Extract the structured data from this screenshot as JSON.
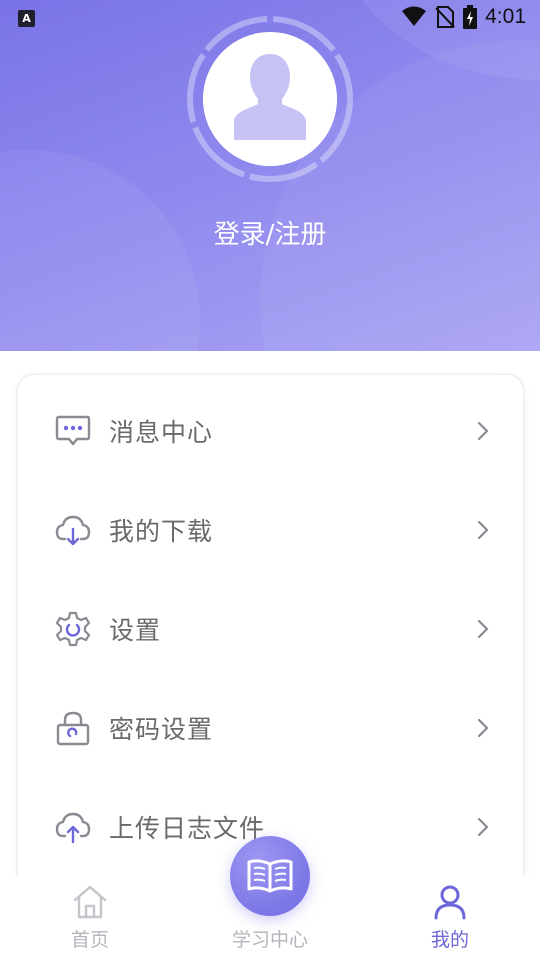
{
  "status_bar": {
    "app_icon_letter": "A",
    "time": "4:01"
  },
  "profile": {
    "login_register": "登录/注册"
  },
  "menu": {
    "items": [
      {
        "label": "消息中心",
        "icon": "message-icon"
      },
      {
        "label": "我的下载",
        "icon": "cloud-download-icon"
      },
      {
        "label": "设置",
        "icon": "gear-icon"
      },
      {
        "label": "密码设置",
        "icon": "lock-icon"
      },
      {
        "label": "上传日志文件",
        "icon": "cloud-upload-icon"
      }
    ]
  },
  "bottom_nav": {
    "home": "首页",
    "study_center": "学习中心",
    "mine": "我的",
    "active_tab": "我的"
  },
  "colors": {
    "accent": "#7a73e6",
    "accent_light": "#aaa4f4",
    "nav_active": "#6d67d9",
    "nav_inactive": "#b5b5bd",
    "menu_text": "#6a6a6a"
  }
}
